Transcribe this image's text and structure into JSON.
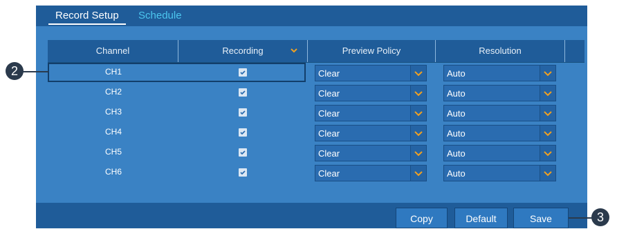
{
  "tabs": [
    {
      "label": "Record Setup",
      "active": true
    },
    {
      "label": "Schedule",
      "active": false
    }
  ],
  "table": {
    "columns": [
      "Channel",
      "Recording",
      "Preview Policy",
      "Resolution"
    ],
    "rows": [
      {
        "channel": "CH1",
        "recording": true,
        "preview_policy": "Clear",
        "resolution": "Auto",
        "selected": true
      },
      {
        "channel": "CH2",
        "recording": true,
        "preview_policy": "Clear",
        "resolution": "Auto"
      },
      {
        "channel": "CH3",
        "recording": true,
        "preview_policy": "Clear",
        "resolution": "Auto"
      },
      {
        "channel": "CH4",
        "recording": true,
        "preview_policy": "Clear",
        "resolution": "Auto"
      },
      {
        "channel": "CH5",
        "recording": true,
        "preview_policy": "Clear",
        "resolution": "Auto"
      },
      {
        "channel": "CH6",
        "recording": true,
        "preview_policy": "Clear",
        "resolution": "Auto"
      }
    ]
  },
  "buttons": {
    "copy": "Copy",
    "default": "Default",
    "save": "Save"
  },
  "callouts": {
    "row": "2",
    "save": "3"
  },
  "colors": {
    "panel": "#3a82c4",
    "header": "#1f5c99",
    "accent_orange": "#f0a020",
    "tab_inactive": "#4cc6ef"
  },
  "icons": {
    "dropdown": "chevron-down-icon",
    "checkbox": "checkbox-checked-icon"
  }
}
